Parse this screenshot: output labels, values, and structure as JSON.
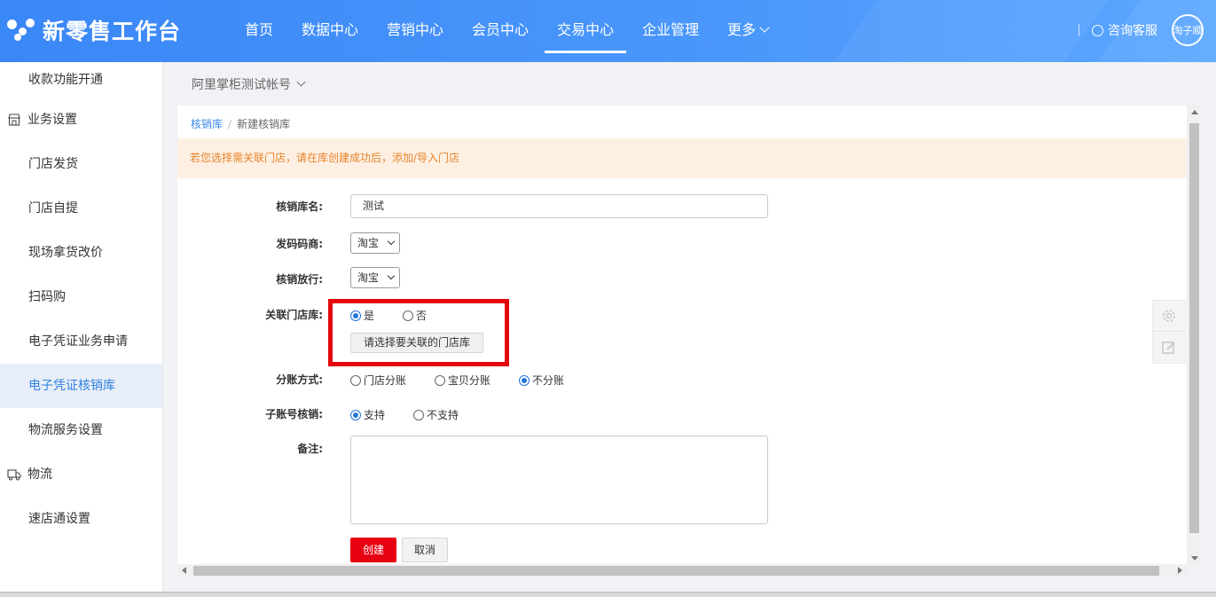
{
  "header": {
    "logo_text": "新零售工作台",
    "nav": [
      {
        "label": "首页",
        "active": false
      },
      {
        "label": "数据中心",
        "active": false
      },
      {
        "label": "营销中心",
        "active": false
      },
      {
        "label": "会员中心",
        "active": false
      },
      {
        "label": "交易中心",
        "active": true
      },
      {
        "label": "企业管理",
        "active": false
      },
      {
        "label": "更多",
        "active": false,
        "dropdown": true
      }
    ],
    "consult_label": "咨询客服",
    "avatar_text": "淘子顺",
    "colors": {
      "bar": "#3c8dfa"
    }
  },
  "sidebar": {
    "items": [
      {
        "label": "收款功能开通",
        "type": "item"
      },
      {
        "label": "业务设置",
        "type": "group",
        "icon": "store-icon"
      },
      {
        "label": "门店发货",
        "type": "item"
      },
      {
        "label": "门店自提",
        "type": "item"
      },
      {
        "label": "现场拿货改价",
        "type": "item"
      },
      {
        "label": "扫码购",
        "type": "item"
      },
      {
        "label": "电子凭证业务申请",
        "type": "item"
      },
      {
        "label": "电子凭证核销库",
        "type": "item",
        "active": true
      },
      {
        "label": "物流服务设置",
        "type": "item"
      },
      {
        "label": "物流",
        "type": "group",
        "icon": "truck-icon"
      },
      {
        "label": "速店通设置",
        "type": "item"
      }
    ]
  },
  "main": {
    "account_label": "阿里掌柜测试帐号",
    "breadcrumb": {
      "parent": "核销库",
      "current": "新建核销库"
    },
    "notice": "若您选择需关联门店，请在库创建成功后，添加/导入门店",
    "form": {
      "name_label": "核销库名:",
      "name_value": "测试",
      "issuer_label": "发码码商:",
      "issuer_value": "淘宝",
      "release_label": "核销放行:",
      "release_value": "淘宝",
      "link_store_label": "关联门店库:",
      "link_store_options": [
        {
          "label": "是",
          "checked": true
        },
        {
          "label": "否",
          "checked": false
        }
      ],
      "select_store_button": "请选择要关联的门店库",
      "split_label": "分账方式:",
      "split_options": [
        {
          "label": "门店分账",
          "checked": false
        },
        {
          "label": "宝贝分账",
          "checked": false
        },
        {
          "label": "不分账",
          "checked": true
        }
      ],
      "subaccount_label": "子账号核销:",
      "subaccount_options": [
        {
          "label": "支持",
          "checked": true
        },
        {
          "label": "不支持",
          "checked": false
        }
      ],
      "remark_label": "备注:",
      "remark_value": "",
      "create_button": "创建",
      "cancel_button": "取消"
    },
    "highlight_color": "#e3070d",
    "tools": [
      {
        "icon": "gear-icon"
      },
      {
        "icon": "edit-icon"
      }
    ]
  }
}
